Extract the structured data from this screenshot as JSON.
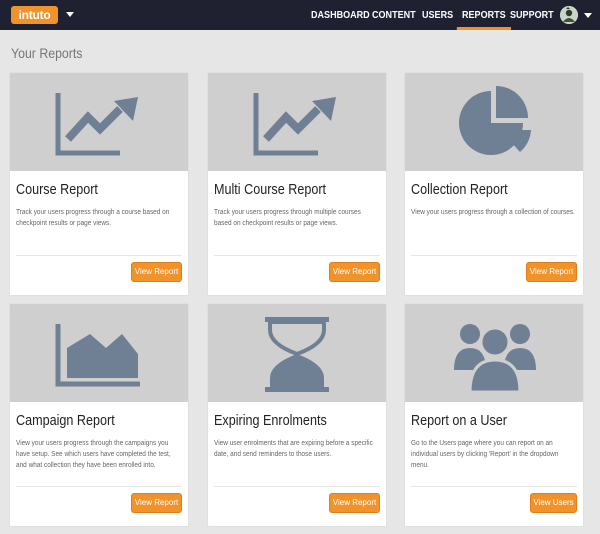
{
  "app": {
    "logo_text": "intuto"
  },
  "nav": {
    "items": [
      "DASHBOARD",
      "CONTENT",
      "USERS",
      "REPORTS",
      "SUPPORT"
    ],
    "active": "REPORTS"
  },
  "page": {
    "title": "Your Reports"
  },
  "colors": {
    "accent": "#f0932b",
    "topbar": "#1f2130",
    "icon": "#6f7f94"
  },
  "cards": [
    {
      "title": "Course Report",
      "description": "Track your users progress through a course based on checkpoint results or page views.",
      "button": "View Report",
      "icon": "line-chart-icon"
    },
    {
      "title": "Multi Course Report",
      "description": "Track your users progress through multiple courses based on checkpoint results or page views.",
      "button": "View Report",
      "icon": "line-chart-icon"
    },
    {
      "title": "Collection Report",
      "description": "View your users progress through a collection of courses.",
      "button": "View Report",
      "icon": "pie-chart-icon"
    },
    {
      "title": "Campaign Report",
      "description": "View your users progress through the campaigns you have setup. See which users have completed the test, and what collection they have been enrolled into.",
      "button": "View Report",
      "icon": "area-chart-icon"
    },
    {
      "title": "Expiring Enrolments",
      "description": "View user enrolments that are expiring before a specific date, and send reminders to those users.",
      "button": "View Report",
      "icon": "hourglass-icon"
    },
    {
      "title": "Report on a User",
      "description": "Go to the Users page where you can report on an individual users by clicking 'Report' in the dropdown menu.",
      "button": "View Users",
      "icon": "users-icon"
    }
  ]
}
